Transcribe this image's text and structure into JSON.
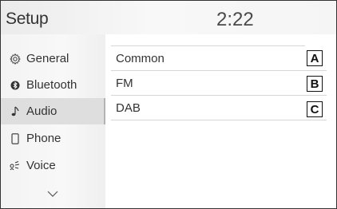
{
  "header": {
    "title": "Setup",
    "clock": "2:22"
  },
  "sidebar": {
    "items": [
      {
        "label": "General",
        "icon": "gear-icon"
      },
      {
        "label": "Bluetooth",
        "icon": "bluetooth-icon"
      },
      {
        "label": "Audio",
        "icon": "music-note-icon",
        "selected": true
      },
      {
        "label": "Phone",
        "icon": "phone-icon"
      },
      {
        "label": "Voice",
        "icon": "voice-icon"
      }
    ],
    "more_icon": "chevron-down-icon"
  },
  "main": {
    "items": [
      {
        "label": "Common",
        "callout": "A"
      },
      {
        "label": "FM",
        "callout": "B"
      },
      {
        "label": "DAB",
        "callout": "C"
      }
    ]
  }
}
